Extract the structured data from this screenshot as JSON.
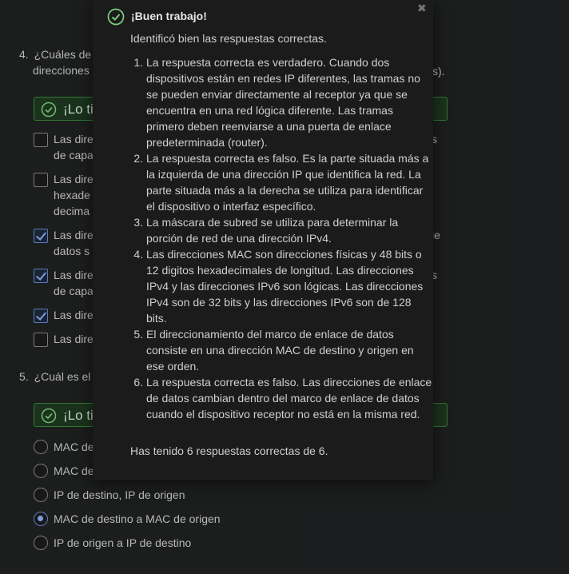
{
  "quiz": {
    "q4": {
      "number": "4.",
      "text_line1": "¿Cuáles de",
      "text_line2": "direcciones",
      "text_tail": "s).",
      "feedback_label": "¡Lo tie",
      "options": [
        {
          "line1": "Las direc",
          "line2": "de capa",
          "tail": "s",
          "checked": false
        },
        {
          "line1": "Las direc",
          "line2": "hexade",
          "line3": "decima",
          "checked": false
        },
        {
          "line1": "Las direc",
          "line2": "datos s",
          "tail": "le",
          "checked": true
        },
        {
          "line1": "Las direc",
          "line2": "de capa",
          "tail": "s",
          "checked": true
        },
        {
          "line1": "Las direc",
          "checked": true
        },
        {
          "line1": "Las direc",
          "checked": false
        }
      ]
    },
    "q5": {
      "number": "5.",
      "text": "¿Cuál es el",
      "feedback_label": "¡Lo tie",
      "options": [
        {
          "label": "MAC de",
          "checked": false
        },
        {
          "label": "MAC de",
          "checked": false
        },
        {
          "label": "IP de destino, IP de origen",
          "checked": false
        },
        {
          "label": "MAC de destino a MAC de origen",
          "checked": true
        },
        {
          "label": "IP de origen a IP de destino",
          "checked": false
        }
      ]
    }
  },
  "popup": {
    "close_glyph": "✖",
    "title": "¡Buen trabajo!",
    "intro": "Identificó bien las respuestas correctas.",
    "items": [
      "La respuesta correcta es verdadero. Cuando dos dispositivos están en redes IP diferentes, las tramas no se pueden enviar directamente al receptor ya que se encuentra en una red lógica diferente. Las tramas primero deben reenviarse a una puerta de enlace predeterminada (router).",
      "La respuesta correcta es falso. Es la parte situada más a la izquierda de una dirección IP que identifica la red. La parte situada más a la derecha se utiliza para identificar el dispositivo o interfaz específico.",
      "La máscara de subred se utiliza para determinar la porción de red de una dirección IPv4.",
      "Las direcciones MAC son direcciones físicas y 48 bits o 12 digitos hexadecimales de longitud. Las direcciones IPv4 y las direcciones IPv6 son lógicas. Las direcciones IPv4 son de 32 bits y las direcciones IPv6 son de 128 bits.",
      "El direccionamiento del marco de enlace de datos consiste en una dirección MAC de destino y origen en ese orden.",
      "La respuesta correcta es falso. Las direcciones de enlace de datos cambian dentro del marco de enlace de datos cuando el dispositivo receptor no está en la misma red."
    ],
    "summary": "Has tenido 6 respuestas correctas de 6."
  },
  "colors": {
    "background": "#202122",
    "popup_bg": "#1b1b1b",
    "success_green": "#3a8a3a",
    "checkbox_accent": "#8fb3ff"
  }
}
